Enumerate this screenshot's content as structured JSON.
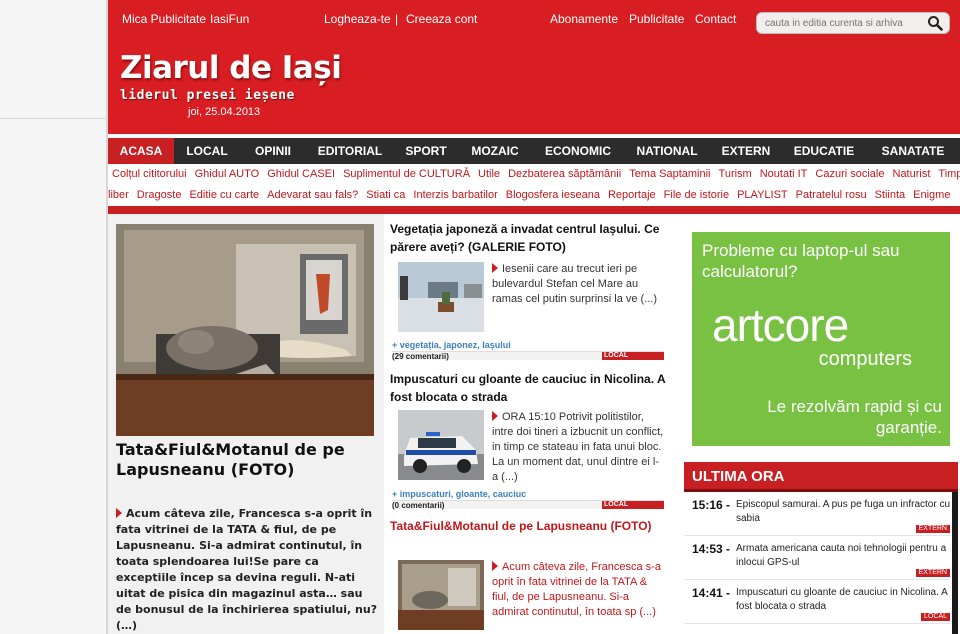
{
  "header": {
    "top_left": [
      "Mica Publicitate",
      "IasiFun"
    ],
    "login": "Logheaza-te",
    "separator": "|",
    "register": "Creeaza cont",
    "top_right": [
      "Abonamente",
      "Publicitate",
      "Contact"
    ],
    "search_placeholder": "cauta in editia curenta si arhiva",
    "logo": "Ziarul de Iași",
    "tagline": "liderul presei ieșene",
    "date": "joi, 25.04.2013"
  },
  "nav": {
    "items": [
      "ACASA",
      "LOCAL",
      "OPINII",
      "EDITORIAL",
      "SPORT",
      "MOZAIC",
      "ECONOMIC",
      "NATIONAL",
      "EXTERN",
      "EDUCATIE",
      "SANATATE"
    ],
    "active": "ACASA"
  },
  "subnav": {
    "row1": [
      "Colțul cititorului",
      "Ghidul AUTO",
      "Ghidul CASEI",
      "Suplimentul de CULTURĂ",
      "Utile",
      "Dezbaterea săptămânii",
      "Tema Saptaminii",
      "Turism",
      "Noutati IT",
      "Cazuri sociale",
      "Naturist",
      "Timp"
    ],
    "row2": [
      "liber",
      "Dragoste",
      "Editie cu carte",
      "Adevarat sau fals?",
      "Stiati ca",
      "Interzis barbatilor",
      "Blogosfera ieseana",
      "Reportaje",
      "File de istorie",
      "PLAYLIST",
      "Patratelul rosu",
      "Stiinta",
      "Enigme"
    ]
  },
  "feature": {
    "title": "Tata&Fiul&Motanul de pe Lapusneanu (FOTO)",
    "text": "Acum câteva zile, Francesca s-a oprit în fata vitrinei de la TATA & fiul, de pe Lapusneanu. Si-a admirat continutul, în toata splendoarea lui!Se pare ca exceptiile încep sa devina reguli. N-ati uitat de pisica din magazinul asta… sau de bonusul de la închirierea spatiului, nu? (…)"
  },
  "articles": [
    {
      "title": "Vegetația japoneză a invadat centrul Iașului. Ce părere aveți? (GALERIE FOTO)",
      "text": "Iesenii care au trecut ieri pe bulevardul Stefan cel Mare au ramas cel putin surprinsi la ve (...)",
      "tags": "+ vegetația, japonez, Iașului",
      "comments": "(29 comentarii)",
      "section": "LOCAL"
    },
    {
      "title": "Impuscaturi cu gloante de cauciuc in Nicolina. A fost blocata o strada",
      "text": "ORA 15:10 Potrivit politistilor, intre doi tineri a izbucnit un conflict, in timp ce stateau in fata unui bloc. La un moment dat, unul dintre ei l-a (...)",
      "tags": "+ impuscaturi, gloante, cauciuc",
      "comments": "(0 comentarii)",
      "section": "LOCAL"
    },
    {
      "title": "Tata&Fiul&Motanul de pe Lapusneanu (FOTO)",
      "text": "Acum câteva zile, Francesca s-a oprit în fata vitrinei de la TATA & fiul, de pe Lapusneanu. Si-a admirat continutul, în toata sp (...)"
    }
  ],
  "ad": {
    "line1": "Probleme cu laptop-ul sau calculatorul?",
    "brand": "artcore",
    "sub": "computers",
    "tagline": "Le rezolvăm rapid și cu garanție."
  },
  "ultima_ora": {
    "title": "ULTIMA ORA",
    "items": [
      {
        "time": "15:16 -",
        "text": "Episcopul samurai. A pus pe fuga un infractor cu sabia",
        "badge": "EXTERN"
      },
      {
        "time": "14:53 -",
        "text": "Armata americana cauta noi tehnologii pentru a inlocui GPS-ul",
        "badge": "EXTERN"
      },
      {
        "time": "14:41 -",
        "text": "Impuscaturi cu gloante de cauciuc in Nicolina. A fost blocata o strada",
        "badge": "LOCAL"
      }
    ]
  },
  "colors": {
    "brand_red": "#d81e22",
    "nav_dark": "#2c2c2c",
    "ad_green": "#78c143"
  }
}
